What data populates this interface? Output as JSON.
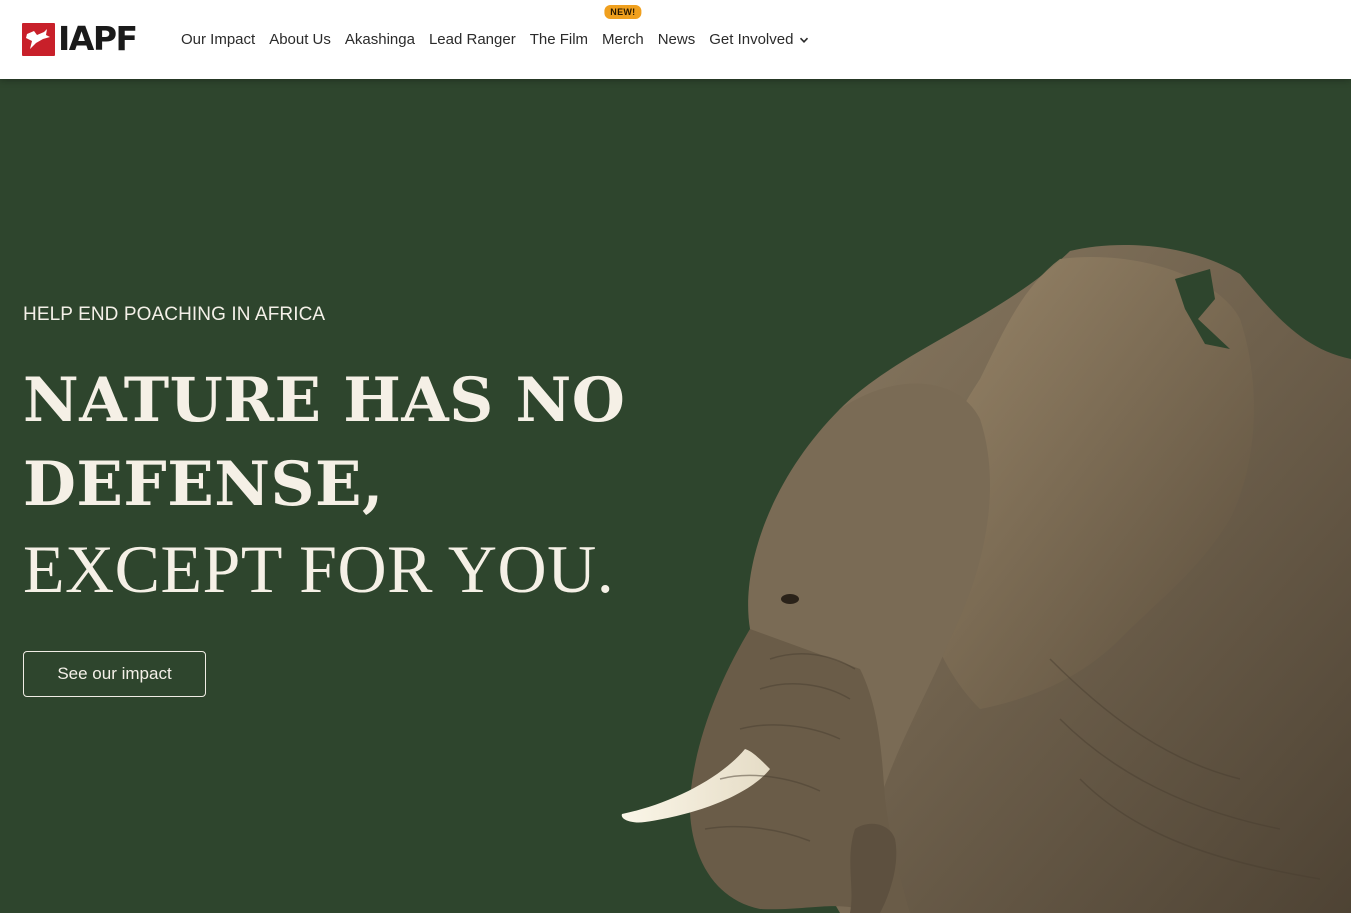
{
  "header": {
    "logo_text": "IAPF",
    "nav": [
      {
        "label": "Our Impact"
      },
      {
        "label": "About Us"
      },
      {
        "label": "Akashinga"
      },
      {
        "label": "Lead Ranger"
      },
      {
        "label": "The Film"
      },
      {
        "label": "Merch",
        "badge": "NEW!"
      },
      {
        "label": "News"
      },
      {
        "label": "Get Involved",
        "icon": "chevron-down-icon"
      }
    ]
  },
  "hero": {
    "eyebrow": "HELP END POACHING IN AFRICA",
    "headline_line1": "NATURE HAS NO",
    "headline_line2": "DEFENSE,",
    "headline_line3": "EXCEPT FOR YOU.",
    "cta_label": "See our impact",
    "image": "elephant-photo"
  },
  "colors": {
    "hero_bg": "#2e452d",
    "badge_bg": "#f0a01e",
    "logo_red": "#c8202a",
    "text_light": "#f5f0e6"
  }
}
